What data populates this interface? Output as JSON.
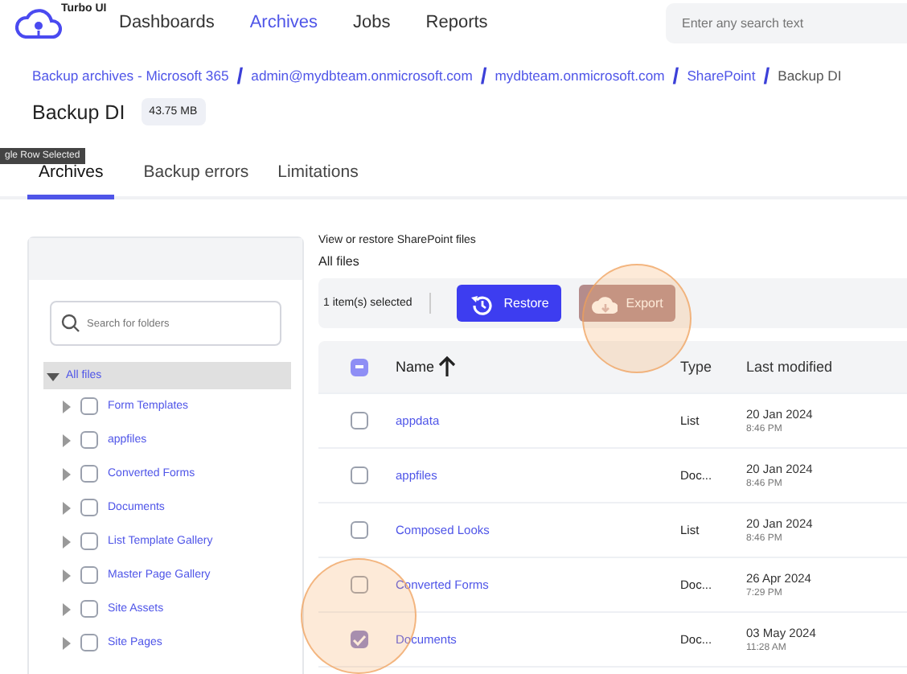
{
  "app": {
    "logo_text": "Turbo UI"
  },
  "nav": [
    {
      "label": "Dashboards",
      "selected": false
    },
    {
      "label": "Archives",
      "selected": true
    },
    {
      "label": "Jobs",
      "selected": false
    },
    {
      "label": "Reports",
      "selected": false
    }
  ],
  "search": {
    "placeholder": "Enter any search text"
  },
  "breadcrumb": [
    {
      "label": "Backup archives - Microsoft 365",
      "link": true
    },
    {
      "label": "admin@mydbteam.onmicrosoft.com",
      "link": true
    },
    {
      "label": "mydbteam.onmicrosoft.com",
      "link": true
    },
    {
      "label": "SharePoint",
      "link": true
    },
    {
      "label": "Backup DI",
      "link": false
    }
  ],
  "separator": "/",
  "title": "Backup DI",
  "size_badge": "43.75 MB",
  "tooltip": "gle Row Selected",
  "tabs": [
    {
      "label": "Archives",
      "selected": true
    },
    {
      "label": "Backup errors",
      "selected": false
    },
    {
      "label": "Limitations",
      "selected": false
    }
  ],
  "folder_search": {
    "placeholder": "Search for folders"
  },
  "tree": {
    "label": "All files",
    "expanded": true,
    "children": [
      {
        "label": "Form Templates",
        "checked": false
      },
      {
        "label": "appfiles",
        "checked": false
      },
      {
        "label": "Converted Forms",
        "checked": false
      },
      {
        "label": "Documents",
        "checked": false
      },
      {
        "label": "List Template Gallery",
        "checked": false
      },
      {
        "label": "Master Page Gallery",
        "checked": false
      },
      {
        "label": "Site Assets",
        "checked": false
      },
      {
        "label": "Site Pages",
        "checked": false
      }
    ]
  },
  "subtitle": "View or restore SharePoint files",
  "section_title": "All files",
  "selection_count": "1 item(s) selected",
  "buttons": [
    {
      "label": "Restore",
      "disabled": false
    },
    {
      "label": "Export",
      "disabled": true
    }
  ],
  "table": {
    "columns": [
      "Name",
      "Type",
      "Last modified"
    ],
    "header_checkbox_partial": true,
    "rows": [
      {
        "name": "appdata",
        "type": "List",
        "date": "20 Jan 2024",
        "time": "8:46 PM",
        "checked": false
      },
      {
        "name": "appfiles",
        "type": "Doc...",
        "date": "20 Jan 2024",
        "time": "8:46 PM",
        "checked": false
      },
      {
        "name": "Composed Looks",
        "type": "List",
        "date": "20 Jan 2024",
        "time": "8:46 PM",
        "checked": false
      },
      {
        "name": "Converted Forms",
        "type": "Doc...",
        "date": "26 Apr 2024",
        "time": "7:29 PM",
        "checked": false
      },
      {
        "name": "Documents",
        "type": "Doc...",
        "date": "03 May 2024",
        "time": "11:28 AM",
        "checked": true
      }
    ]
  }
}
